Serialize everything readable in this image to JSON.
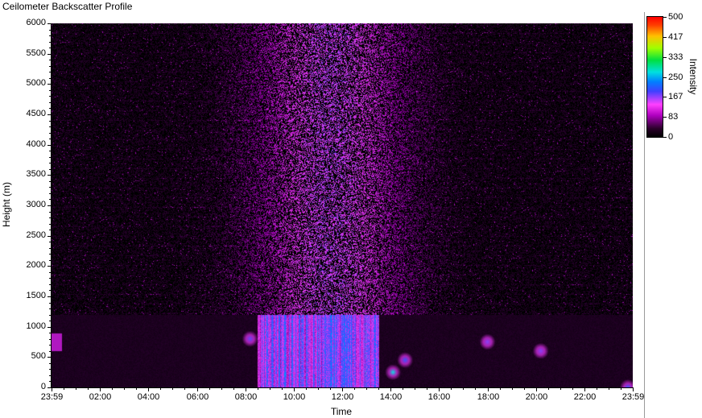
{
  "window": {
    "title": "Ceilometer Backscatter Profile"
  },
  "chart_data": {
    "type": "heatmap",
    "title": "Ceilometer Backscatter Profile",
    "xlabel": "Time",
    "ylabel": "Height (m)",
    "x_ticks": [
      "23:59",
      "02:00",
      "04:00",
      "06:00",
      "08:00",
      "10:00",
      "12:00",
      "14:00",
      "16:00",
      "18:00",
      "20:00",
      "22:00",
      "23:59"
    ],
    "x_range_hours": [
      0,
      24
    ],
    "y_ticks": [
      0,
      500,
      1000,
      1500,
      2000,
      2500,
      3000,
      3500,
      4000,
      4500,
      5000,
      5500,
      6000
    ],
    "ylim": [
      0,
      6000
    ],
    "colorbar": {
      "label": "Intensity",
      "ticks": [
        500,
        417,
        333,
        250,
        167,
        83,
        0
      ],
      "range": [
        0,
        500
      ],
      "colors": [
        "#000000",
        "#b000c0",
        "#ff40ff",
        "#4040ff",
        "#00e0e0",
        "#00e040",
        "#a0ff00",
        "#ffc000",
        "#ff0000"
      ]
    },
    "features": {
      "mixing_layer_top_m": 1200,
      "strong_echoes": [
        {
          "time_h": 8.2,
          "height_m": 800,
          "intensity": 180
        },
        {
          "time_h": 14.1,
          "height_m": 250,
          "intensity": 280
        },
        {
          "time_h": 14.6,
          "height_m": 450,
          "intensity": 200
        },
        {
          "time_h": 18.0,
          "height_m": 750,
          "intensity": 170
        },
        {
          "time_h": 20.2,
          "height_m": 600,
          "intensity": 170
        },
        {
          "time_h": 23.8,
          "height_m": 0,
          "intensity": 200
        }
      ]
    }
  }
}
